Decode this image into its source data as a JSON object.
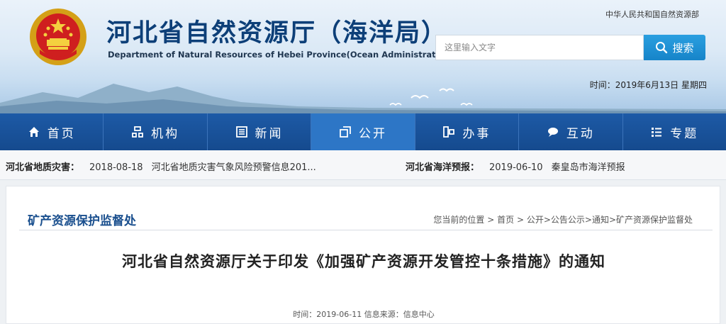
{
  "header": {
    "title": "河北省自然资源厅（海洋局）",
    "subtitle": "Department of Natural Resources of Hebei Province(Ocean  Administration)",
    "ministry_link": "中华人民共和国自然资源部",
    "search_placeholder": "这里输入文字",
    "search_button": "搜索",
    "date": "时间：2019年6月13日 星期四"
  },
  "nav": {
    "items": [
      {
        "label": "首页",
        "icon": "home-icon"
      },
      {
        "label": "机构",
        "icon": "org-icon"
      },
      {
        "label": "新闻",
        "icon": "news-icon"
      },
      {
        "label": "公开",
        "icon": "open-icon"
      },
      {
        "label": "办事",
        "icon": "service-icon"
      },
      {
        "label": "互动",
        "icon": "chat-icon"
      },
      {
        "label": "专题",
        "icon": "list-icon"
      }
    ],
    "active": "公开"
  },
  "ticker": {
    "left": {
      "label": "河北省地质灾害：",
      "date": "2018-08-18",
      "text": "河北省地质灾害气象风险预警信息201..."
    },
    "right": {
      "label": "河北省海洋预报：",
      "date": "2019-06-10",
      "text": "秦皇岛市海洋预报"
    }
  },
  "content": {
    "section_title": "矿产资源保护监督处",
    "breadcrumb": {
      "prefix": "您当前的位置",
      "sep": " > ",
      "home": "首页",
      "path": "公开>公告公示>通知>矿产资源保护监督处"
    },
    "article_title": "河北省自然资源厅关于印发《加强矿产资源开发管控十条措施》的通知",
    "meta": "时间：2019-06-11 信息来源：信息中心"
  },
  "colors": {
    "nav_bg": "#1d5aa6",
    "nav_active": "#2d76c6",
    "title_blue": "#0d3f78",
    "search_button": "#1684c9"
  }
}
